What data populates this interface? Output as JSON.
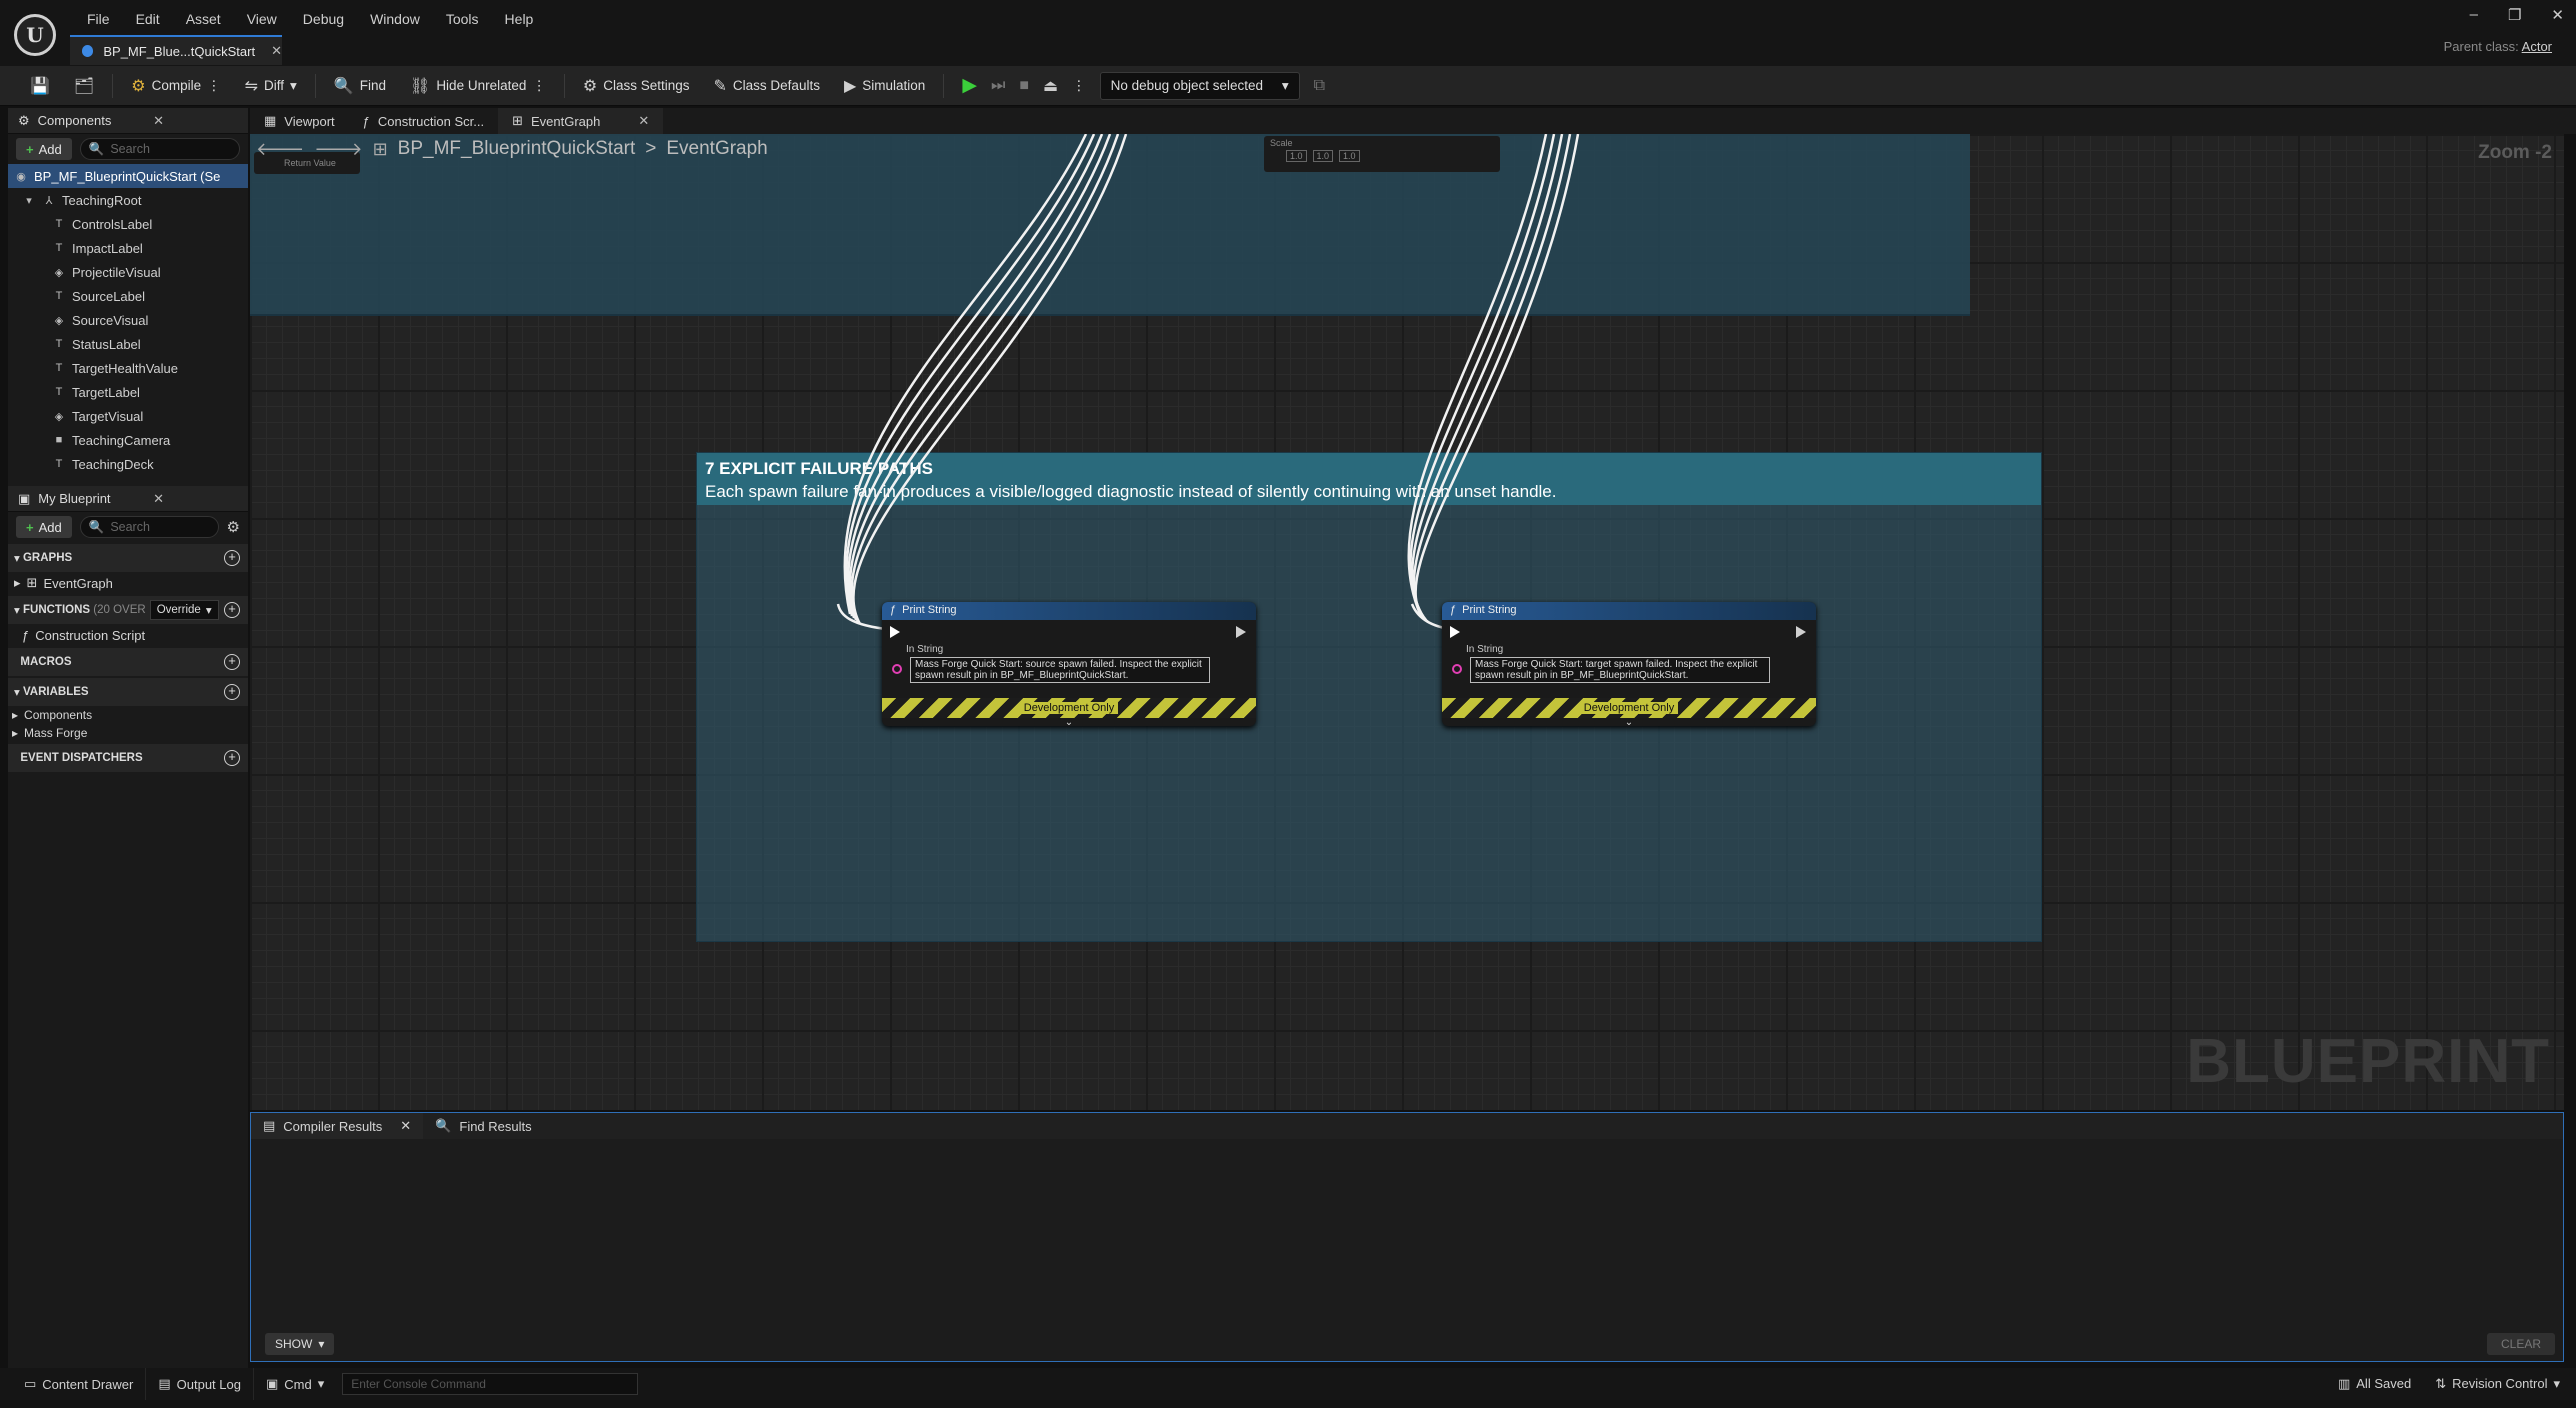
{
  "menu": {
    "items": [
      "File",
      "Edit",
      "Asset",
      "View",
      "Debug",
      "Window",
      "Tools",
      "Help"
    ],
    "asset_tab": "BP_MF_Blue...tQuickStart",
    "parent_class_label": "Parent class:",
    "parent_class_value": "Actor"
  },
  "toolbar": {
    "compile": "Compile",
    "diff": "Diff",
    "find": "Find",
    "hide_unrelated": "Hide Unrelated",
    "class_settings": "Class Settings",
    "class_defaults": "Class Defaults",
    "simulation": "Simulation",
    "debug_object": "No debug object selected"
  },
  "components_panel": {
    "title": "Components",
    "add_label": "Add",
    "search_placeholder": "Search",
    "root": "BP_MF_BlueprintQuickStart (Se",
    "teaching_root": "TeachingRoot",
    "items": [
      "ControlsLabel",
      "ImpactLabel",
      "ProjectileVisual",
      "SourceLabel",
      "SourceVisual",
      "StatusLabel",
      "TargetHealthValue",
      "TargetLabel",
      "TargetVisual",
      "TeachingCamera",
      "TeachingDeck"
    ]
  },
  "my_blueprint": {
    "title": "My Blueprint",
    "add_label": "Add",
    "search_placeholder": "Search",
    "graphs_header": "GRAPHS",
    "graph_item": "EventGraph",
    "functions_header": "FUNCTIONS",
    "functions_count": "(20 OVER",
    "override_label": "Override",
    "function_item": "Construction Script",
    "macros_header": "MACROS",
    "variables_header": "VARIABLES",
    "variable_groups": [
      "Components",
      "Mass Forge"
    ],
    "dispatchers_header": "EVENT DISPATCHERS"
  },
  "doc_tabs": {
    "viewport": "Viewport",
    "construction": "Construction Scr...",
    "eventgraph": "EventGraph"
  },
  "graph": {
    "breadcrumb_root": "BP_MF_BlueprintQuickStart",
    "breadcrumb_sep": ">",
    "breadcrumb_current": "EventGraph",
    "zoom": "Zoom -2",
    "scale_label": "Scale",
    "scale_values": [
      "1.0",
      "1.0",
      "1.0"
    ],
    "return_value": "Return Value",
    "comment_title": "7  EXPLICIT FAILURE PATHS",
    "comment_subtitle": "Each spawn failure fan-in produces a visible/logged diagnostic instead of silently continuing with an unset handle.",
    "nodes": [
      {
        "title": "Print String",
        "pin_label": "In String",
        "text": "Mass Forge Quick Start: source spawn failed. Inspect the explicit spawn result pin in BP_MF_BlueprintQuickStart.",
        "dev_label": "Development Only"
      },
      {
        "title": "Print String",
        "pin_label": "In String",
        "text": "Mass Forge Quick Start: target spawn failed. Inspect the explicit spawn result pin in BP_MF_BlueprintQuickStart.",
        "dev_label": "Development Only"
      }
    ],
    "watermark": "BLUEPRINT"
  },
  "bottom": {
    "compiler_results": "Compiler Results",
    "find_results": "Find Results",
    "show": "SHOW",
    "clear": "CLEAR"
  },
  "statusbar": {
    "content_drawer": "Content Drawer",
    "output_log": "Output Log",
    "cmd": "Cmd",
    "console_placeholder": "Enter Console Command",
    "all_saved": "All Saved",
    "revision_control": "Revision Control"
  }
}
